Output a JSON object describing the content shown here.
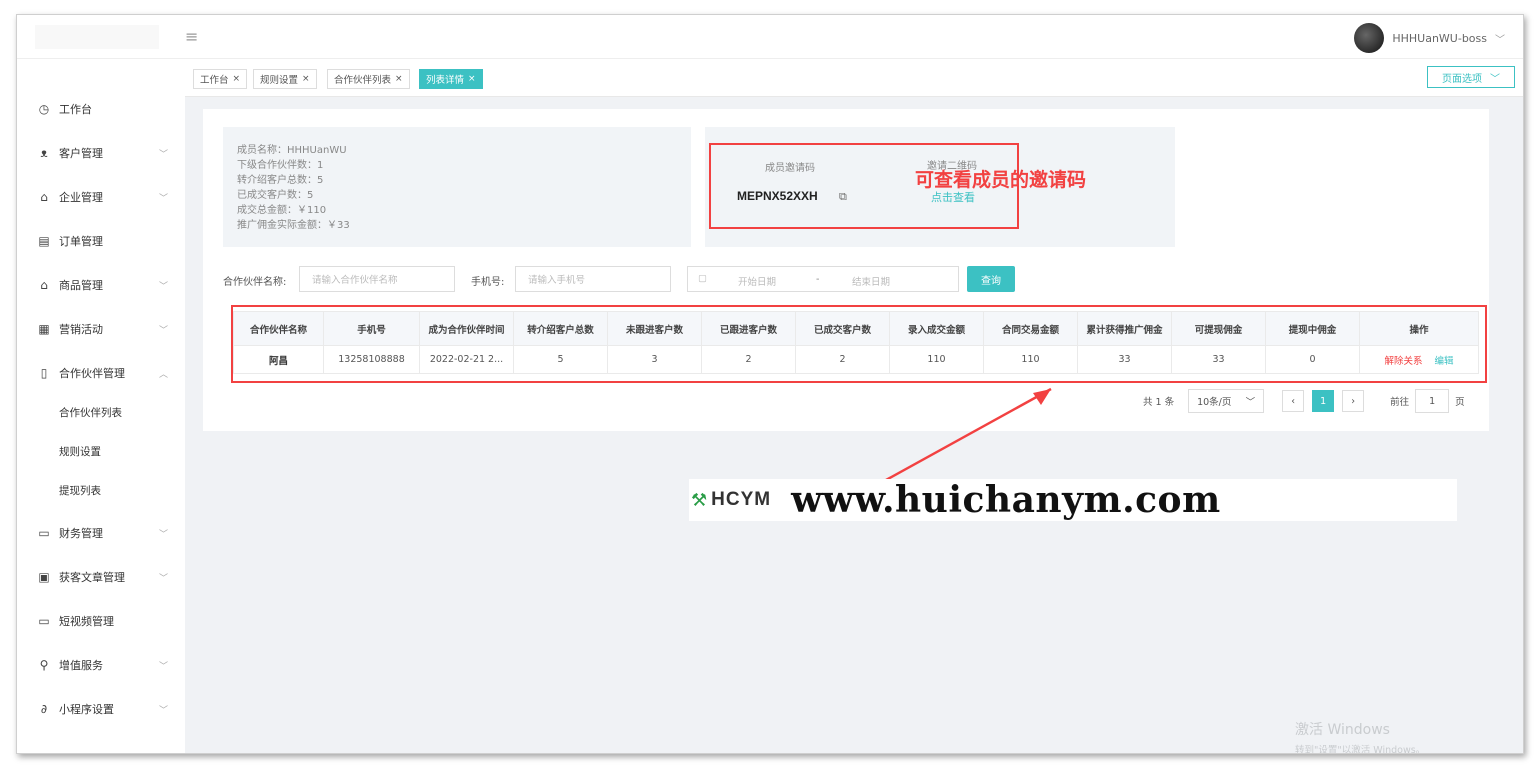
{
  "topbar": {
    "menu_icon": "hamburger-icon",
    "username": "HHHUanWU-boss",
    "dropdown_icon": "chevron-down-icon"
  },
  "sidebar": {
    "items": [
      {
        "label": "工作台",
        "icon": "dashboard-icon"
      },
      {
        "label": "客户管理",
        "icon": "users-icon"
      },
      {
        "label": "企业管理",
        "icon": "bank-icon"
      },
      {
        "label": "订单管理",
        "icon": "document-icon"
      },
      {
        "label": "商品管理",
        "icon": "shop-icon"
      },
      {
        "label": "营销活动",
        "icon": "gift-icon"
      },
      {
        "label": "合作伙伴管理",
        "icon": "phone-icon"
      },
      {
        "label": "财务管理",
        "icon": "wallet-icon"
      },
      {
        "label": "获客文章管理",
        "icon": "article-icon"
      },
      {
        "label": "短视频管理",
        "icon": "video-icon"
      },
      {
        "label": "增值服务",
        "icon": "search-icon"
      },
      {
        "label": "小程序设置",
        "icon": "link-icon"
      }
    ],
    "sub_items": [
      "合作伙伴列表",
      "规则设置",
      "提现列表"
    ]
  },
  "tabs": [
    {
      "label": "工作台"
    },
    {
      "label": "规则设置"
    },
    {
      "label": "合作伙伴列表"
    },
    {
      "label": "列表详情"
    }
  ],
  "page_select_label": "页面选项",
  "member_info": {
    "name": "成员名称：HHHUanWU",
    "sub_partners": "下级合作伙伴数：1",
    "referred_customers": "转介绍客户总数：5",
    "deals": "已成交客户数：5",
    "deal_amount": "成交总金额：￥110",
    "commission": "推广佣金实际金额：￥33"
  },
  "invite": {
    "code_label": "成员邀请码",
    "code": "MEPNX52XXH",
    "qr_label": "邀请二维码",
    "view_link": "点击查看"
  },
  "annotation_top": "可查看成员的邀请码",
  "filters": {
    "partner_name_label": "合作伙伴名称:",
    "partner_name_placeholder": "请输入合作伙伴名称",
    "phone_label": "手机号:",
    "phone_placeholder": "请输入手机号",
    "date_start_placeholder": "开始日期",
    "date_separator": "-",
    "date_end_placeholder": "结束日期",
    "query_button": "查询"
  },
  "table": {
    "headers": [
      "合作伙伴名称",
      "手机号",
      "成为合作伙伴时间",
      "转介绍客户总数",
      "未跟进客户数",
      "已跟进客户数",
      "已成交客户数",
      "录入成交金额",
      "合同交易金额",
      "累计获得推广佣金",
      "可提现佣金",
      "提现中佣金",
      "操作"
    ],
    "rows": [
      [
        "阿昌",
        "13258108888",
        "2022-02-21 2...",
        "5",
        "3",
        "2",
        "2",
        "110",
        "110",
        "33",
        "33",
        "0"
      ]
    ],
    "op_unbind": "解除关系",
    "op_edit": "编辑"
  },
  "pagination": {
    "total": "共 1 条",
    "page_size": "10条/页",
    "current_page": "1",
    "goto_label": "前往",
    "goto_value": "1",
    "page_suffix": "页"
  },
  "watermark": {
    "logo_text": "HCYM",
    "url": "www.huichanym.com"
  },
  "windows_activation": {
    "title": "激活 Windows",
    "subtitle": "转到\"设置\"以激活 Windows。"
  },
  "colors": {
    "accent": "#3cc1c3",
    "annotation_red": "#f24141"
  }
}
